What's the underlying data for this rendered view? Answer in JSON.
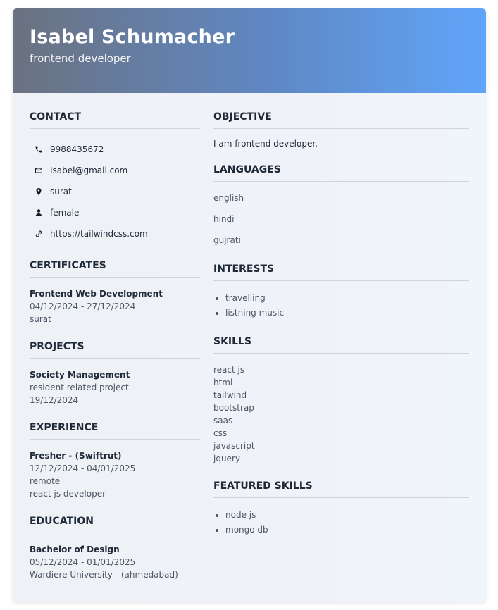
{
  "header": {
    "name": "Isabel Schumacher",
    "role": "frontend developer"
  },
  "contact": {
    "title": "CONTACT",
    "phone": "9988435672",
    "email": "Isabel@gmail.com",
    "location": "surat",
    "gender": "female",
    "website": "https://tailwindcss.com"
  },
  "certificates": {
    "title": "CERTIFICATES",
    "name": "Frontend Web Development",
    "dates": "04/12/2024 - 27/12/2024",
    "place": "surat"
  },
  "projects": {
    "title": "PROJECTS",
    "name": "Society Management",
    "desc": "resident related project",
    "date": "19/12/2024"
  },
  "experience": {
    "title": "EXPERIENCE",
    "role": "Fresher - (Swiftrut)",
    "dates": "12/12/2024 - 04/01/2025",
    "mode": "remote",
    "desc": "react js developer"
  },
  "education": {
    "title": "EDUCATION",
    "degree": "Bachelor of Design",
    "dates": "05/12/2024 - 01/01/2025",
    "school": "Wardiere University - (ahmedabad)"
  },
  "objective": {
    "title": "OBJECTIVE",
    "text": "I am frontend developer."
  },
  "languages": {
    "title": "LANGUAGES",
    "items": [
      "english",
      "hindi",
      "gujrati"
    ]
  },
  "interests": {
    "title": "INTERESTS",
    "items": [
      "travelling",
      "listning music"
    ]
  },
  "skills": {
    "title": "SKILLS",
    "items": [
      "react js",
      "html",
      "tailwind",
      "bootstrap",
      "saas",
      "css",
      "javascript",
      "jquery"
    ]
  },
  "featured_skills": {
    "title": "FEATURED SKILLS",
    "items": [
      "node js",
      "mongo db"
    ]
  }
}
